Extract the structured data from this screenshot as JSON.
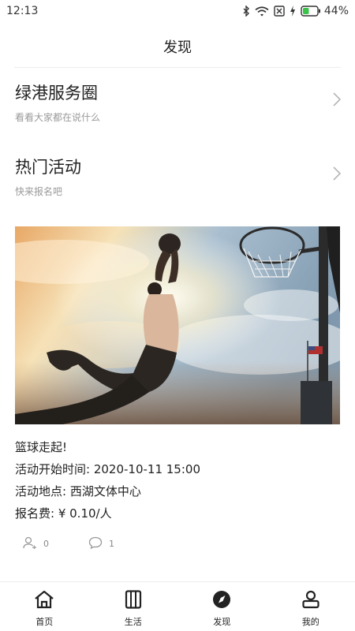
{
  "status": {
    "time": "12:13",
    "battery_percent": "44%",
    "battery_level": 0.44,
    "icons": [
      "bluetooth-icon",
      "wifi-icon",
      "sim-none-icon",
      "charging-icon",
      "battery-icon"
    ]
  },
  "header": {
    "title": "发现"
  },
  "entries": [
    {
      "title": "绿港服务圈",
      "subtitle": "看看大家都在说什么"
    },
    {
      "title": "热门活动",
      "subtitle": "快来报名吧"
    }
  ],
  "event": {
    "image": "basketball-dunk-photo",
    "name": "篮球走起!",
    "start_time": "活动开始时间: 2020-10-11 15:00",
    "location": "活动地点: 西湖文体中心",
    "fee": "报名费: ¥ 0.10/人",
    "participants": "0",
    "comments": "1"
  },
  "tabbar": {
    "items": [
      {
        "label": "首页",
        "icon": "home-icon"
      },
      {
        "label": "生活",
        "icon": "life-icon"
      },
      {
        "label": "发现",
        "icon": "discover-icon",
        "active": true
      },
      {
        "label": "我的",
        "icon": "profile-icon"
      }
    ]
  }
}
